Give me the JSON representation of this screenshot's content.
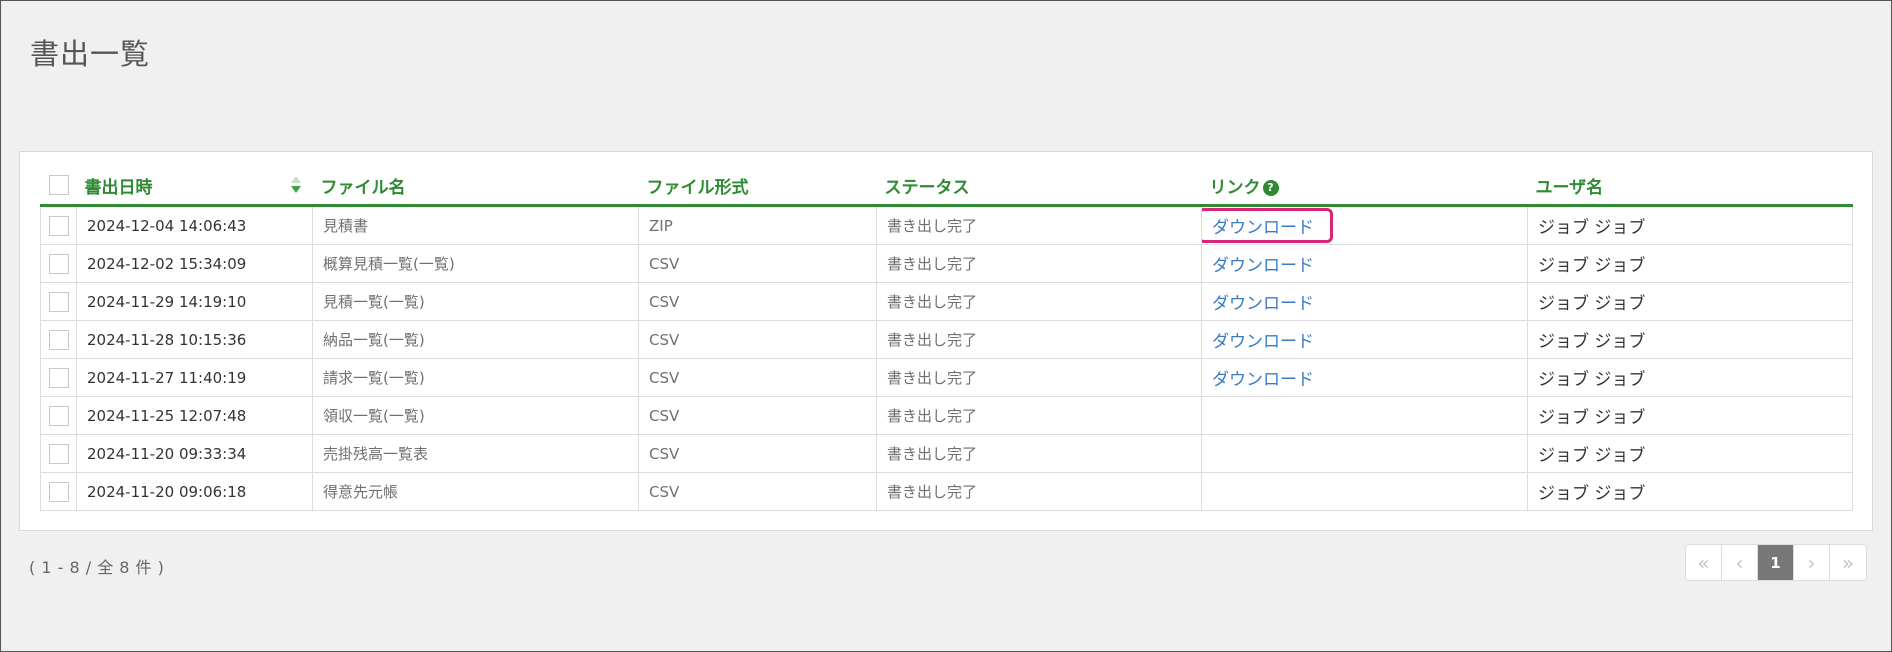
{
  "page": {
    "title": "書出一覧"
  },
  "table": {
    "headers": {
      "datetime": "書出日時",
      "filename": "ファイル名",
      "format": "ファイル形式",
      "status": "ステータス",
      "link": "リンク",
      "link_help": "?",
      "user": "ユーザ名"
    },
    "rows": [
      {
        "datetime": "2024-12-04 14:06:43",
        "filename": "見積書",
        "format": "ZIP",
        "status": "書き出し完了",
        "link": "ダウンロード",
        "user": "ジョブ ジョブ"
      },
      {
        "datetime": "2024-12-02 15:34:09",
        "filename": "概算見積一覧(一覧)",
        "format": "CSV",
        "status": "書き出し完了",
        "link": "ダウンロード",
        "user": "ジョブ ジョブ"
      },
      {
        "datetime": "2024-11-29 14:19:10",
        "filename": "見積一覧(一覧)",
        "format": "CSV",
        "status": "書き出し完了",
        "link": "ダウンロード",
        "user": "ジョブ ジョブ"
      },
      {
        "datetime": "2024-11-28 10:15:36",
        "filename": "納品一覧(一覧)",
        "format": "CSV",
        "status": "書き出し完了",
        "link": "ダウンロード",
        "user": "ジョブ ジョブ"
      },
      {
        "datetime": "2024-11-27 11:40:19",
        "filename": "請求一覧(一覧)",
        "format": "CSV",
        "status": "書き出し完了",
        "link": "ダウンロード",
        "user": "ジョブ ジョブ"
      },
      {
        "datetime": "2024-11-25 12:07:48",
        "filename": "領収一覧(一覧)",
        "format": "CSV",
        "status": "書き出し完了",
        "link": "",
        "user": "ジョブ ジョブ"
      },
      {
        "datetime": "2024-11-20 09:33:34",
        "filename": "売掛残高一覧表",
        "format": "CSV",
        "status": "書き出し完了",
        "link": "",
        "user": "ジョブ ジョブ"
      },
      {
        "datetime": "2024-11-20 09:06:18",
        "filename": "得意先元帳",
        "format": "CSV",
        "status": "書き出し完了",
        "link": "",
        "user": "ジョブ ジョブ"
      }
    ]
  },
  "footer": {
    "range_info": "( 1 - 8 / 全 8 件 )"
  },
  "pagination": {
    "first": "«",
    "prev": "‹",
    "current": "1",
    "next": "›",
    "last": "»"
  },
  "colors": {
    "accent_green": "#2e8b32",
    "link_blue": "#3a7cc4",
    "highlight_pink": "#d6267a"
  }
}
